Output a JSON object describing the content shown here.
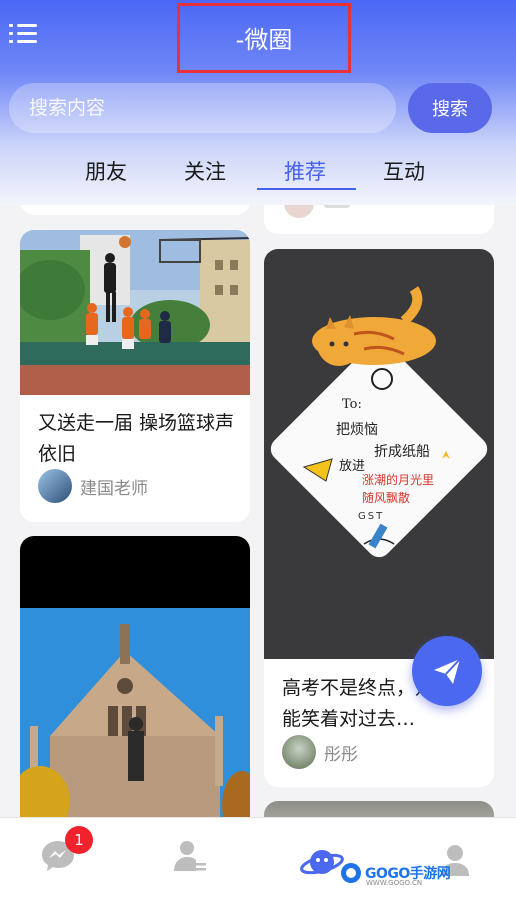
{
  "header": {
    "title": "-微圈",
    "search_placeholder": "搜索内容",
    "search_button": "搜索"
  },
  "tabs": [
    {
      "label": "朋友",
      "active": false
    },
    {
      "label": "关注",
      "active": false
    },
    {
      "label": "推荐",
      "active": true
    },
    {
      "label": "互动",
      "active": false
    }
  ],
  "feed": {
    "left": [
      {
        "title": "又送走一届 操场篮球声依旧",
        "author": "建国老师"
      }
    ],
    "right": [
      {
        "title": "高考不是终点，是终于能笑着对过去…",
        "author": "彤彤"
      }
    ],
    "card_image_text": {
      "to": "To:",
      "line1": "把烦恼",
      "line2": "折成纸船",
      "line3": "放进",
      "line4": "涨潮的月光里",
      "line5": "随风飘散",
      "sign": "GST"
    }
  },
  "bottom_nav": {
    "badge_count": "1",
    "items": [
      "messages-icon",
      "contacts-icon",
      "planet-icon",
      "profile-icon"
    ]
  },
  "watermark": {
    "text": "GOGO手游网",
    "sub": "WWW.GOGO.CN"
  },
  "colors": {
    "accent": "#4762e9",
    "badge": "#f2222d",
    "title_highlight": "#e8323a"
  }
}
